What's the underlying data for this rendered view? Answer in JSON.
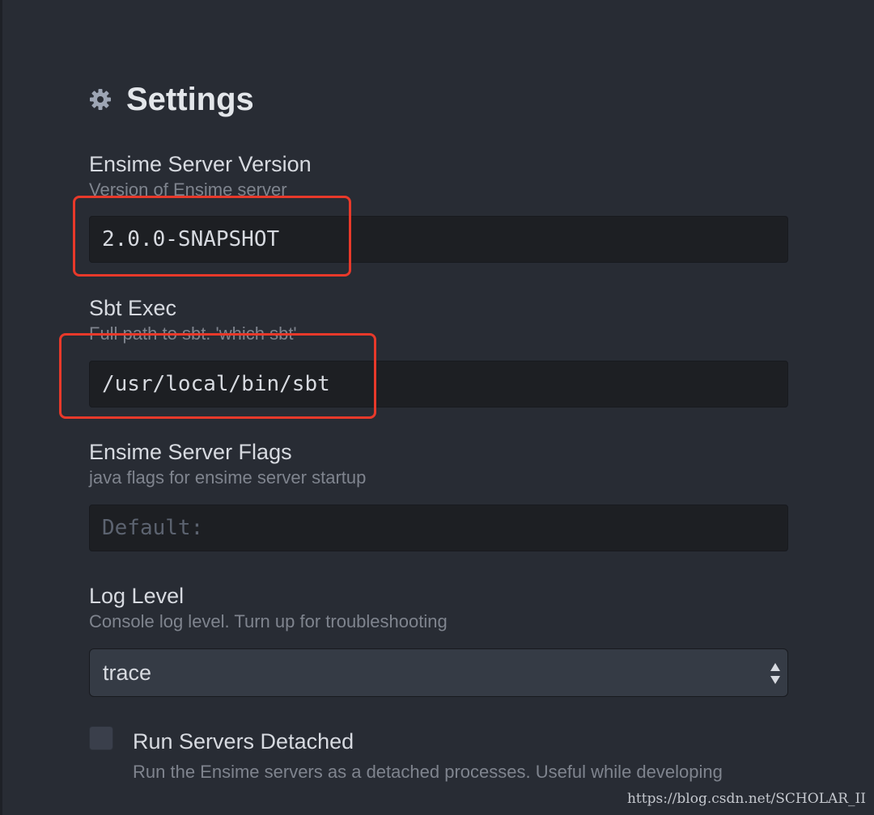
{
  "header": {
    "title": "Settings",
    "icon": "gear-icon"
  },
  "settings": [
    {
      "label": "Ensime Server Version",
      "description": "Version of Ensime server",
      "value": "2.0.0-SNAPSHOT",
      "placeholder": ""
    },
    {
      "label": "Sbt Exec",
      "description": "Full path to sbt. 'which sbt'",
      "value": "/usr/local/bin/sbt",
      "placeholder": ""
    },
    {
      "label": "Ensime Server Flags",
      "description": "java flags for ensime server startup",
      "value": "",
      "placeholder": "Default:"
    }
  ],
  "log_level": {
    "label": "Log Level",
    "description": "Console log level. Turn up for troubleshooting",
    "selected": "trace"
  },
  "run_detached": {
    "label": "Run Servers Detached",
    "description": "Run the Ensime servers as a detached processes. Useful while developing",
    "checked": false
  },
  "watermark": "https://blog.csdn.net/SCHOLAR_II",
  "colors": {
    "background": "#282c34",
    "input_background": "#1d1f23",
    "highlight": "#e8392a"
  }
}
